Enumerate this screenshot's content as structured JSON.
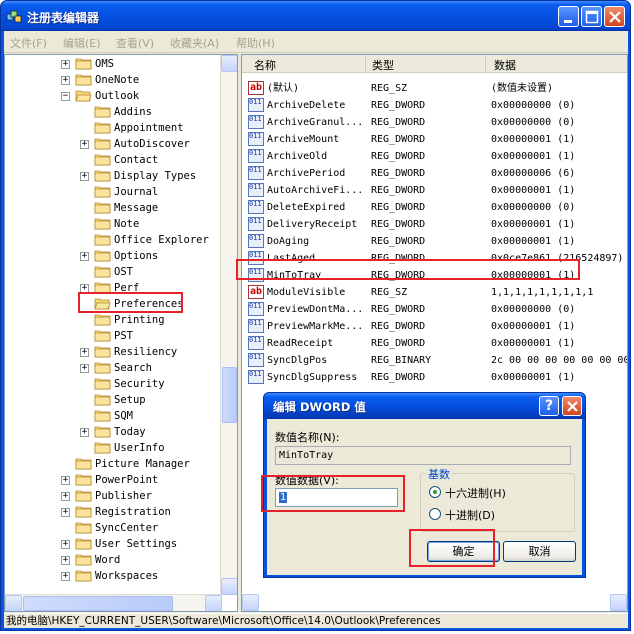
{
  "window": {
    "title": "注册表编辑器"
  },
  "menu": [
    "文件(F)",
    "编辑(E)",
    "查看(V)",
    "收藏夹(A)",
    "帮助(H)"
  ],
  "tree": {
    "rows": [
      {
        "label": "OMS",
        "expander": "+"
      },
      {
        "label": "OneNote",
        "expander": "+"
      },
      {
        "label": "Outlook",
        "expander": "-"
      },
      {
        "label": "Addins",
        "expander": ""
      },
      {
        "label": "Appointment",
        "expander": ""
      },
      {
        "label": "AutoDiscover",
        "expander": "+"
      },
      {
        "label": "Contact",
        "expander": ""
      },
      {
        "label": "Display Types",
        "expander": "+"
      },
      {
        "label": "Journal",
        "expander": ""
      },
      {
        "label": "Message",
        "expander": ""
      },
      {
        "label": "Note",
        "expander": ""
      },
      {
        "label": "Office Explorer",
        "expander": ""
      },
      {
        "label": "Options",
        "expander": "+"
      },
      {
        "label": "OST",
        "expander": ""
      },
      {
        "label": "Perf",
        "expander": "+"
      },
      {
        "label": "Preferences",
        "expander": ""
      },
      {
        "label": "Printing",
        "expander": ""
      },
      {
        "label": "PST",
        "expander": ""
      },
      {
        "label": "Resiliency",
        "expander": "+"
      },
      {
        "label": "Search",
        "expander": "+"
      },
      {
        "label": "Security",
        "expander": ""
      },
      {
        "label": "Setup",
        "expander": ""
      },
      {
        "label": "SQM",
        "expander": ""
      },
      {
        "label": "Today",
        "expander": "+"
      },
      {
        "label": "UserInfo",
        "expander": ""
      },
      {
        "label": "Picture Manager",
        "expander": ""
      },
      {
        "label": "PowerPoint",
        "expander": "+"
      },
      {
        "label": "Publisher",
        "expander": "+"
      },
      {
        "label": "Registration",
        "expander": "+"
      },
      {
        "label": "SyncCenter",
        "expander": ""
      },
      {
        "label": "User Settings",
        "expander": "+"
      },
      {
        "label": "Word",
        "expander": "+"
      },
      {
        "label": "Workspaces",
        "expander": "+"
      }
    ]
  },
  "list": {
    "headers": {
      "name": "名称",
      "type": "类型",
      "data": "数据"
    },
    "rows": [
      {
        "name": "(默认)",
        "type": "REG_SZ",
        "data": "(数值未设置)",
        "icon": "string-value-icon"
      },
      {
        "name": "ArchiveDelete",
        "type": "REG_DWORD",
        "data": "0x00000000 (0)",
        "icon": "binary-value-icon"
      },
      {
        "name": "ArchiveGranul...",
        "type": "REG_DWORD",
        "data": "0x00000000 (0)",
        "icon": "binary-value-icon"
      },
      {
        "name": "ArchiveMount",
        "type": "REG_DWORD",
        "data": "0x00000001 (1)",
        "icon": "binary-value-icon"
      },
      {
        "name": "ArchiveOld",
        "type": "REG_DWORD",
        "data": "0x00000001 (1)",
        "icon": "binary-value-icon"
      },
      {
        "name": "ArchivePeriod",
        "type": "REG_DWORD",
        "data": "0x00000006 (6)",
        "icon": "binary-value-icon"
      },
      {
        "name": "AutoArchiveFi...",
        "type": "REG_DWORD",
        "data": "0x00000001 (1)",
        "icon": "binary-value-icon"
      },
      {
        "name": "DeleteExpired",
        "type": "REG_DWORD",
        "data": "0x00000000 (0)",
        "icon": "binary-value-icon"
      },
      {
        "name": "DeliveryReceipt",
        "type": "REG_DWORD",
        "data": "0x00000001 (1)",
        "icon": "binary-value-icon"
      },
      {
        "name": "DoAging",
        "type": "REG_DWORD",
        "data": "0x00000001 (1)",
        "icon": "binary-value-icon"
      },
      {
        "name": "LastAged",
        "type": "REG_DWORD",
        "data": "0x0ce7e861 (216524897)",
        "icon": "binary-value-icon"
      },
      {
        "name": "MinToTray",
        "type": "REG_DWORD",
        "data": "0x00000001 (1)",
        "icon": "binary-value-icon"
      },
      {
        "name": "ModuleVisible",
        "type": "REG_SZ",
        "data": "1,1,1,1,1,1,1,1,1",
        "icon": "string-value-icon"
      },
      {
        "name": "PreviewDontMa...",
        "type": "REG_DWORD",
        "data": "0x00000000 (0)",
        "icon": "binary-value-icon"
      },
      {
        "name": "PreviewMarkMe...",
        "type": "REG_DWORD",
        "data": "0x00000001 (1)",
        "icon": "binary-value-icon"
      },
      {
        "name": "ReadReceipt",
        "type": "REG_DWORD",
        "data": "0x00000001 (1)",
        "icon": "binary-value-icon"
      },
      {
        "name": "SyncDlgPos",
        "type": "REG_BINARY",
        "data": "2c 00 00 00 00 00 00 00",
        "icon": "binary-value-icon"
      },
      {
        "name": "SyncDlgSuppress",
        "type": "REG_DWORD",
        "data": "0x00000001 (1)",
        "icon": "binary-value-icon"
      }
    ]
  },
  "statusbar": {
    "path": "我的电脑\\HKEY_CURRENT_USER\\Software\\Microsoft\\Office\\14.0\\Outlook\\Preferences"
  },
  "dialog": {
    "title": "编辑 DWORD 值",
    "help_glyph": "?",
    "value_name_label": "数值名称(N):",
    "value_name": "MinToTray",
    "value_data_label": "数值数据(V):",
    "value_data": "1",
    "base_label": "基数",
    "radio_hex": "十六进制(H)",
    "radio_dec": "十进制(D)",
    "selected_base": "hex",
    "ok_label": "确定",
    "cancel_label": "取消"
  },
  "colors": {
    "highlight": "#e8222a",
    "titlebar": "#0550e0"
  }
}
